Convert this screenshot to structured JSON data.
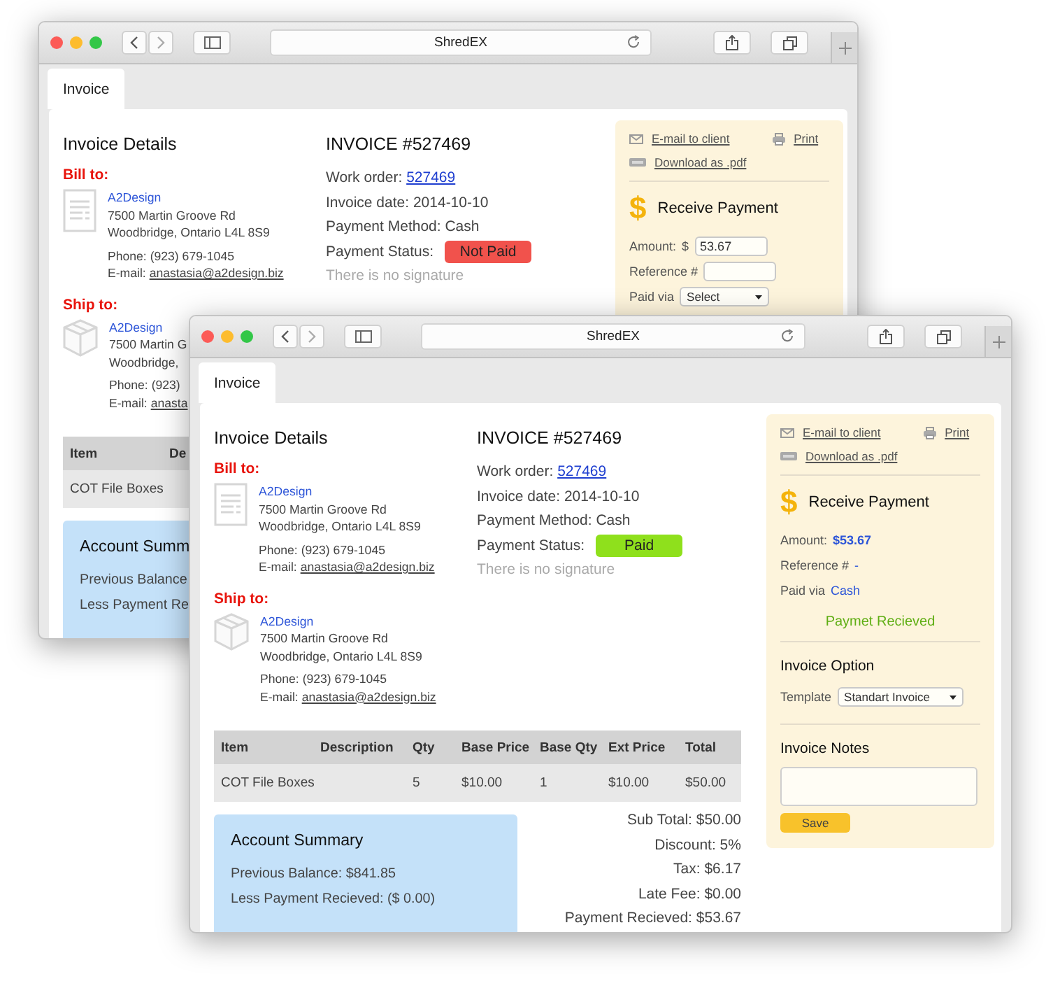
{
  "windows": [
    {
      "title": "ShredEX",
      "tabs": [
        {
          "label": "Invoice",
          "selected": true
        }
      ],
      "details_heading": "Invoice Details",
      "bill_to": {
        "label": "Bill to:",
        "name": "A2Design",
        "address": [
          "7500 Martin Groove Rd",
          "Woodbridge, Ontario L4L 8S9"
        ],
        "phone": "Phone: (923) 679-1045",
        "email_label": "E-mail:",
        "email": "anastasia@a2design.biz"
      },
      "ship_to": {
        "label": "Ship to:",
        "name": "A2Design",
        "address": [
          "7500 Martin G",
          "Woodbridge,"
        ],
        "phone": "Phone: (923)",
        "email_label": "E-mail:",
        "email": "anasta"
      },
      "invoice": {
        "heading": "INVOICE #527469",
        "work_order_label": "Work order:",
        "work_order": "527469",
        "lines": [
          "Invoice date: 2014-10-10",
          "Payment Method: Cash"
        ],
        "status_label": "Payment Status:",
        "status": {
          "label": "Not Paid",
          "kind": "not_paid"
        },
        "signature": "There is no signature"
      },
      "actions": [
        {
          "label": "E-mail to client",
          "kind": "mail"
        },
        {
          "label": "Print",
          "kind": "print"
        },
        {
          "label": "Download as .pdf",
          "kind": "pdf"
        }
      ],
      "payment": {
        "icon": "$",
        "heading": "Receive Payment",
        "fields": [
          {
            "kind": "input",
            "label": "Amount:",
            "prefix": "$",
            "value": "53.67"
          },
          {
            "kind": "input",
            "label": "Reference #"
          },
          {
            "kind": "select",
            "label": "Paid via",
            "value": "Select"
          }
        ]
      },
      "table": {
        "columns": [
          "Item",
          "De"
        ],
        "rows": [
          [
            "COT File Boxes"
          ]
        ]
      },
      "account_summary": {
        "heading": "Account Summ",
        "lines": [
          "Previous Balance",
          "Less Payment Re"
        ]
      }
    },
    {
      "title": "ShredEX",
      "tabs": [
        {
          "label": "Invoice",
          "selected": true
        }
      ],
      "details_heading": "Invoice Details",
      "bill_to": {
        "label": "Bill to:",
        "name": "A2Design",
        "address": [
          "7500 Martin Groove Rd",
          "Woodbridge, Ontario L4L 8S9"
        ],
        "phone": "Phone: (923) 679-1045",
        "email_label": "E-mail:",
        "email": "anastasia@a2design.biz"
      },
      "ship_to": {
        "label": "Ship to:",
        "name": "A2Design",
        "address": [
          "7500 Martin Groove Rd",
          "Woodbridge, Ontario L4L 8S9"
        ],
        "phone": "Phone: (923) 679-1045",
        "email_label": "E-mail:",
        "email": "anastasia@a2design.biz"
      },
      "invoice": {
        "heading": "INVOICE #527469",
        "work_order_label": "Work order:",
        "work_order": "527469",
        "lines": [
          "Invoice date: 2014-10-10",
          "Payment Method: Cash"
        ],
        "status_label": "Payment Status:",
        "status": {
          "label": "Paid",
          "kind": "paid"
        },
        "signature": "There is no signature"
      },
      "actions": [
        {
          "label": "E-mail to client",
          "kind": "mail"
        },
        {
          "label": "Print",
          "kind": "print"
        },
        {
          "label": "Download as .pdf",
          "kind": "pdf"
        }
      ],
      "payment": {
        "icon": "$",
        "heading": "Receive Payment",
        "fields": [
          {
            "kind": "text",
            "label": "Amount:",
            "value": "$53.67"
          },
          {
            "kind": "text",
            "label": "Reference #",
            "value": "-"
          },
          {
            "kind": "text",
            "label": "Paid via",
            "value": "Cash"
          }
        ],
        "message": "Paymet Recieved"
      },
      "invoice_option": {
        "heading": "Invoice Option",
        "label": "Template",
        "value": "Standart Invoice"
      },
      "notes": {
        "heading": "Invoice Notes",
        "button": "Save"
      },
      "table": {
        "columns": [
          "Item",
          "Description",
          "Qty",
          "Base Price",
          "Base Qty",
          "Ext Price",
          "Total"
        ],
        "rows": [
          [
            "COT File Boxes",
            "",
            "5",
            "$10.00",
            "1",
            "$10.00",
            "$50.00"
          ]
        ]
      },
      "totals": [
        "Sub Total: $50.00",
        "Discount: 5%",
        "Tax: $6.17",
        "Late Fee: $0.00",
        "Payment Recieved: $53.67"
      ],
      "account_summary": {
        "heading": "Account Summary",
        "lines": [
          "Previous Balance: $841.85",
          "Less Payment Recieved: ($ 0.00)"
        ]
      }
    }
  ]
}
